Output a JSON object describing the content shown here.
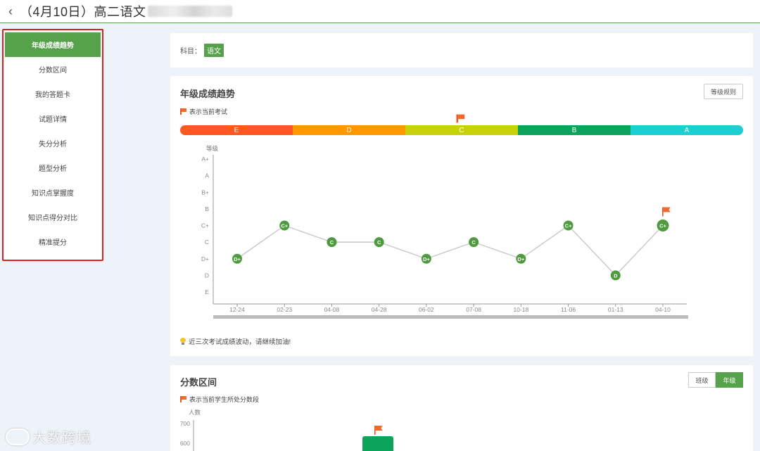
{
  "header": {
    "back_icon": "chevron-left-icon",
    "title": "（4月10日）高二语文"
  },
  "sidebar": {
    "items": [
      {
        "label": "年级成绩趋势",
        "active": true
      },
      {
        "label": "分数区间"
      },
      {
        "label": "我的答题卡"
      },
      {
        "label": "试题详情"
      },
      {
        "label": "失分分析"
      },
      {
        "label": "题型分析"
      },
      {
        "label": "知识点掌握度"
      },
      {
        "label": "知识点得分对比"
      },
      {
        "label": "精准提分"
      }
    ]
  },
  "subject": {
    "label": "科目：",
    "value": "语文"
  },
  "trend": {
    "title": "年级成绩趋势",
    "rule_button": "等级规则",
    "legend_note": "表示当前考试",
    "grade_bands": [
      {
        "label": "E",
        "color": "#ff5722"
      },
      {
        "label": "D",
        "color": "#ff9800"
      },
      {
        "label": "C",
        "color": "#c6d20a"
      },
      {
        "label": "B",
        "color": "#0ba45a"
      },
      {
        "label": "A",
        "color": "#1ccfd0"
      }
    ],
    "current_band": "C",
    "tip": "近三次考试成绩波动，请继续加油!"
  },
  "chart_data": {
    "type": "line",
    "ylabel": "等级",
    "y_levels": [
      "E",
      "D",
      "D+",
      "C",
      "C+",
      "B",
      "B+",
      "A",
      "A+"
    ],
    "categories": [
      "12-24",
      "02-23",
      "04-08",
      "04-28",
      "06-02",
      "07-08",
      "10-18",
      "11-06",
      "01-13",
      "04-10"
    ],
    "values": [
      "D+",
      "C+",
      "C",
      "C",
      "D+",
      "C",
      "D+",
      "C+",
      "D",
      "C+"
    ],
    "current_index": 9,
    "point_color": "#4e9a3e",
    "line_color": "#c8c8c8"
  },
  "distribution": {
    "title": "分数区间",
    "legend_note": "表示当前学生所处分数段",
    "toggle": [
      {
        "label": "班级",
        "on": false
      },
      {
        "label": "年级",
        "on": true
      }
    ],
    "ylabel": "人数",
    "y_ticks": [
      "700",
      "600"
    ],
    "bar_color": "#0ba45a"
  },
  "watermark": "大数跨境"
}
